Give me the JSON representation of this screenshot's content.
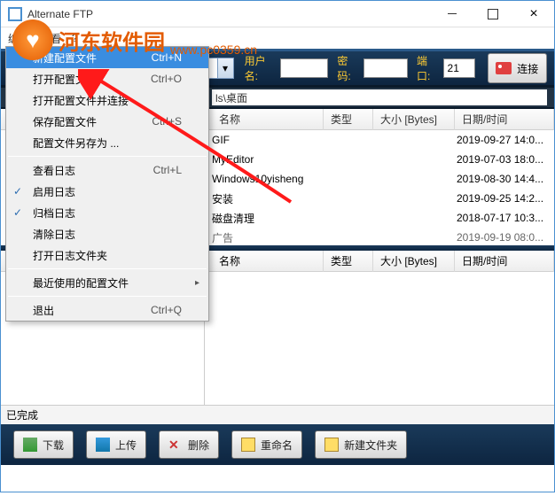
{
  "window": {
    "title": "Alternate FTP"
  },
  "menubar": {
    "edit": "编辑",
    "view": "查看",
    "help": "?"
  },
  "toolbar": {
    "user_label": "用户名:",
    "pass_label": "密码:",
    "port_label": "端口:",
    "port_value": "21",
    "connect": "连接"
  },
  "path": {
    "text": "ls\\桌面"
  },
  "columns": {
    "name": "名称",
    "type": "类型",
    "size": "大小 [Bytes]",
    "date": "日期/时间"
  },
  "files": [
    {
      "name": "GIF",
      "type": "",
      "size": "",
      "date": "2019-09-27 14:0..."
    },
    {
      "name": "MyEditor",
      "type": "",
      "size": "",
      "date": "2019-07-03 18:0..."
    },
    {
      "name": "Windows10yisheng",
      "type": "",
      "size": "",
      "date": "2019-08-30 14:4..."
    },
    {
      "name": "安装",
      "type": "",
      "size": "",
      "date": "2019-09-25 14:2..."
    },
    {
      "name": "磁盘清理",
      "type": "",
      "size": "",
      "date": "2018-07-17 10:3..."
    },
    {
      "name": "广告",
      "type": "",
      "size": "",
      "date": "2019-09-19 08:0..."
    }
  ],
  "ctx": {
    "new_profile": {
      "label": "新建配置文件",
      "shortcut": "Ctrl+N"
    },
    "open_profile": {
      "label": "打开配置文件",
      "shortcut": "Ctrl+O"
    },
    "open_connect": {
      "label": "打开配置文件并连接",
      "shortcut": ""
    },
    "save_profile": {
      "label": "保存配置文件",
      "shortcut": "Ctrl+S"
    },
    "save_as": {
      "label": "配置文件另存为 ...",
      "shortcut": ""
    },
    "view_log": {
      "label": "查看日志",
      "shortcut": "Ctrl+L"
    },
    "enable_log": {
      "label": "启用日志",
      "shortcut": ""
    },
    "archive_log": {
      "label": "归档日志",
      "shortcut": ""
    },
    "clear_log": {
      "label": "清除日志",
      "shortcut": ""
    },
    "open_log_dir": {
      "label": "打开日志文件夹",
      "shortcut": ""
    },
    "recent": {
      "label": "最近使用的配置文件",
      "shortcut": ""
    },
    "exit": {
      "label": "退出",
      "shortcut": "Ctrl+Q"
    }
  },
  "status": {
    "text": "已完成"
  },
  "bottom": {
    "download": "下载",
    "upload": "上传",
    "delete": "删除",
    "rename": "重命名",
    "newfolder": "新建文件夹"
  },
  "watermark": {
    "brand": "河东软件园",
    "url": "www.pc0359.cn"
  }
}
